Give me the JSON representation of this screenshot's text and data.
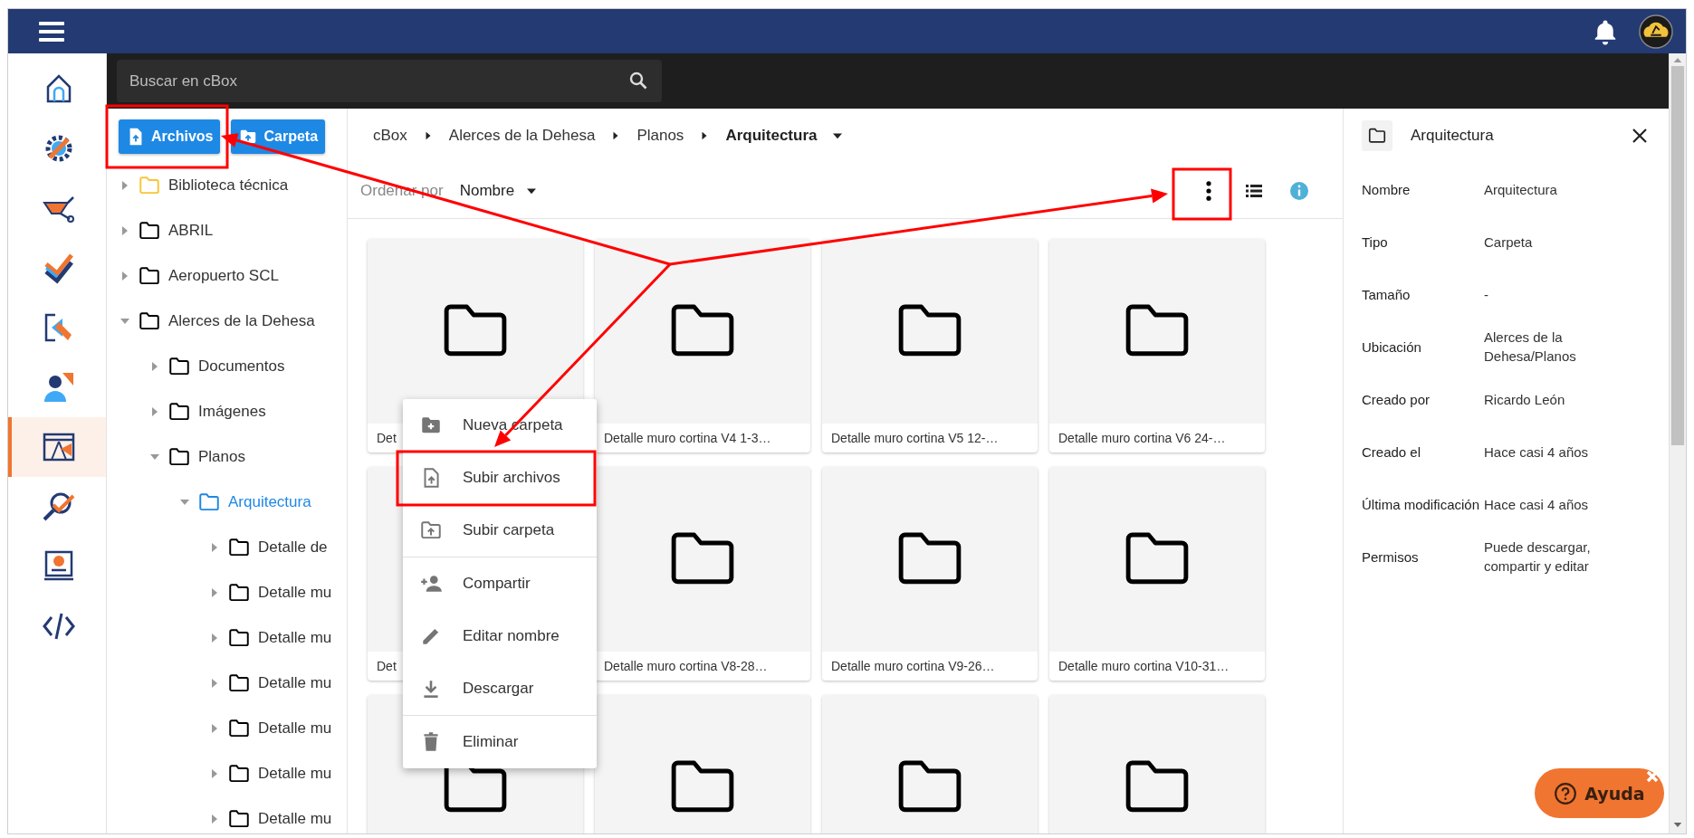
{
  "rail": [
    {
      "selected": false
    },
    {
      "selected": false
    },
    {
      "selected": false
    },
    {
      "selected": false
    },
    {
      "selected": false
    },
    {
      "selected": false
    },
    {
      "selected": true
    },
    {
      "selected": false
    },
    {
      "selected": false
    },
    {
      "selected": false
    }
  ],
  "search": {
    "placeholder": "Buscar en cBox"
  },
  "actions": [
    {
      "label": "Archivos",
      "kind": "file"
    },
    {
      "label": "Carpeta",
      "kind": "folder"
    }
  ],
  "tree": [
    {
      "label": "Biblioteca técnica",
      "color": "#f8c537",
      "expanded": false,
      "selected": false
    },
    {
      "label": "ABRIL",
      "color": "#000000",
      "expanded": false,
      "selected": false
    },
    {
      "label": "Aeropuerto SCL",
      "color": "#000000",
      "expanded": false,
      "selected": false
    },
    {
      "label": "Alerces de la Dehesa",
      "color": "#000000",
      "expanded": true,
      "selected": false,
      "children": [
        {
          "label": "Documentos",
          "expanded": false,
          "selected": false
        },
        {
          "label": "Imágenes",
          "expanded": false,
          "selected": false
        },
        {
          "label": "Planos",
          "expanded": true,
          "selected": false,
          "children": [
            {
              "label": "Arquitectura",
              "expanded": true,
              "selected": true,
              "children": [
                {
                  "label": "Detalle de",
                  "expanded": false,
                  "selected": false
                },
                {
                  "label": "Detalle mu",
                  "expanded": false,
                  "selected": false
                },
                {
                  "label": "Detalle mu",
                  "expanded": false,
                  "selected": false
                },
                {
                  "label": "Detalle mu",
                  "expanded": false,
                  "selected": false
                },
                {
                  "label": "Detalle mu",
                  "expanded": false,
                  "selected": false
                },
                {
                  "label": "Detalle mu",
                  "expanded": false,
                  "selected": false
                },
                {
                  "label": "Detalle mu",
                  "expanded": false,
                  "selected": false
                }
              ]
            }
          ]
        }
      ]
    }
  ],
  "breadcrumb": [
    {
      "label": "cBox",
      "kind": "link"
    },
    {
      "label": "Alerces de la Dehesa",
      "kind": "link"
    },
    {
      "label": "Planos",
      "kind": "link"
    },
    {
      "label": "Arquitectura",
      "kind": "current"
    }
  ],
  "sort": {
    "label": "Ordenar por",
    "value": "Nombre"
  },
  "cards": [
    {
      "kind": "folder",
      "label": "Det"
    },
    {
      "kind": "folder",
      "label": "Detalle muro cortina V4 1-3…"
    },
    {
      "kind": "folder",
      "label": "Detalle muro cortina V5 12-…"
    },
    {
      "kind": "folder",
      "label": "Detalle muro cortina V6 24-…"
    },
    {
      "kind": "folder",
      "label": "Det"
    },
    {
      "kind": "folder",
      "label": "Detalle muro cortina V8-28…"
    },
    {
      "kind": "folder",
      "label": "Detalle muro cortina V9-26…"
    },
    {
      "kind": "folder",
      "label": "Detalle muro cortina V10-31…"
    },
    {
      "kind": "folder"
    },
    {
      "kind": "folder"
    },
    {
      "kind": "folder"
    },
    {
      "kind": "folder"
    }
  ],
  "menu": {
    "groups": [
      [
        {
          "label": "Nueva carpeta",
          "kind": "new-folder"
        },
        {
          "label": "Subir archivos",
          "kind": "upload-file"
        },
        {
          "label": "Subir carpeta",
          "kind": "upload-folder"
        }
      ],
      [
        {
          "label": "Compartir",
          "kind": "share"
        },
        {
          "label": "Editar nombre",
          "kind": "rename"
        },
        {
          "label": "Descargar",
          "kind": "download"
        }
      ],
      [
        {
          "label": "Eliminar",
          "kind": "delete"
        }
      ]
    ]
  },
  "details": {
    "title": "Arquitectura",
    "rows": [
      {
        "label": "Nombre",
        "value": "Arquitectura"
      },
      {
        "label": "Tipo",
        "value": "Carpeta"
      },
      {
        "label": "Tamaño",
        "value": "-"
      },
      {
        "label": "Ubicación",
        "value": "Alerces de la Dehesa/Planos"
      },
      {
        "label": "Creado por",
        "value": "Ricardo León"
      },
      {
        "label": "Creado el",
        "value": "Hace casi 4 años"
      },
      {
        "label": "Última modificación",
        "value": "Hace casi 4 años"
      },
      {
        "label": "Permisos",
        "value": "Puede descargar, compartir y editar"
      }
    ]
  },
  "help": {
    "label": "Ayuda"
  }
}
